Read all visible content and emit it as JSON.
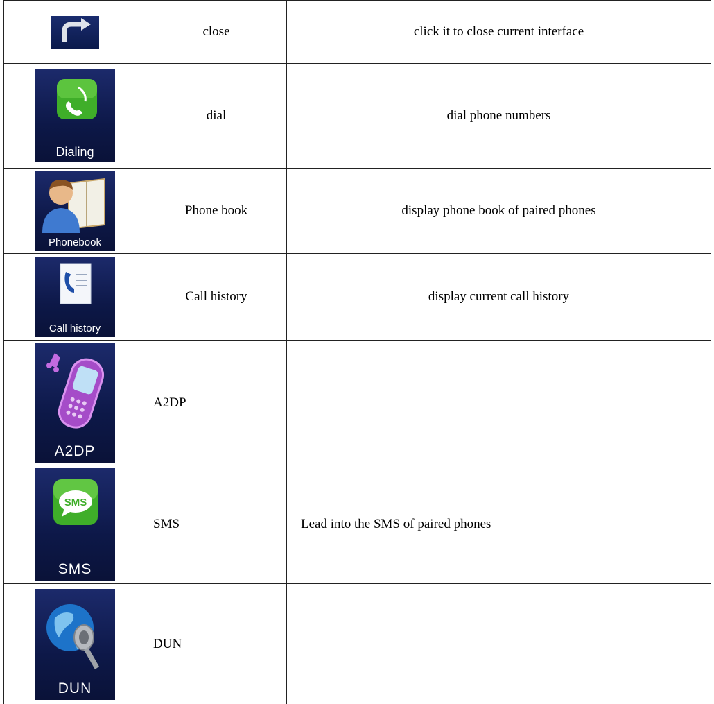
{
  "rows": [
    {
      "icon": "back-arrow-icon",
      "icon_label": "",
      "name": "close",
      "desc": "click it to close current interface"
    },
    {
      "icon": "phone-handset-icon",
      "icon_label": "Dialing",
      "name": "dial",
      "desc": "dial phone numbers"
    },
    {
      "icon": "contact-book-icon",
      "icon_label": "Phonebook",
      "name": "Phone book",
      "desc": "display phone book of paired phones"
    },
    {
      "icon": "call-log-icon",
      "icon_label": "Call history",
      "name": "Call history",
      "desc": "display current call history"
    },
    {
      "icon": "music-phone-icon",
      "icon_label": "A2DP",
      "name": "A2DP",
      "desc": ""
    },
    {
      "icon": "sms-bubble-icon",
      "icon_label": "SMS",
      "name": "SMS",
      "desc": "Lead into the SMS of paired phones",
      "icon_text": "SMS"
    },
    {
      "icon": "globe-connector-icon",
      "icon_label": "DUN",
      "name": "DUN",
      "desc": ""
    }
  ],
  "colors": {
    "icon_bg": "#0d1848",
    "green": "#3fae29",
    "purple": "#b455d6"
  }
}
